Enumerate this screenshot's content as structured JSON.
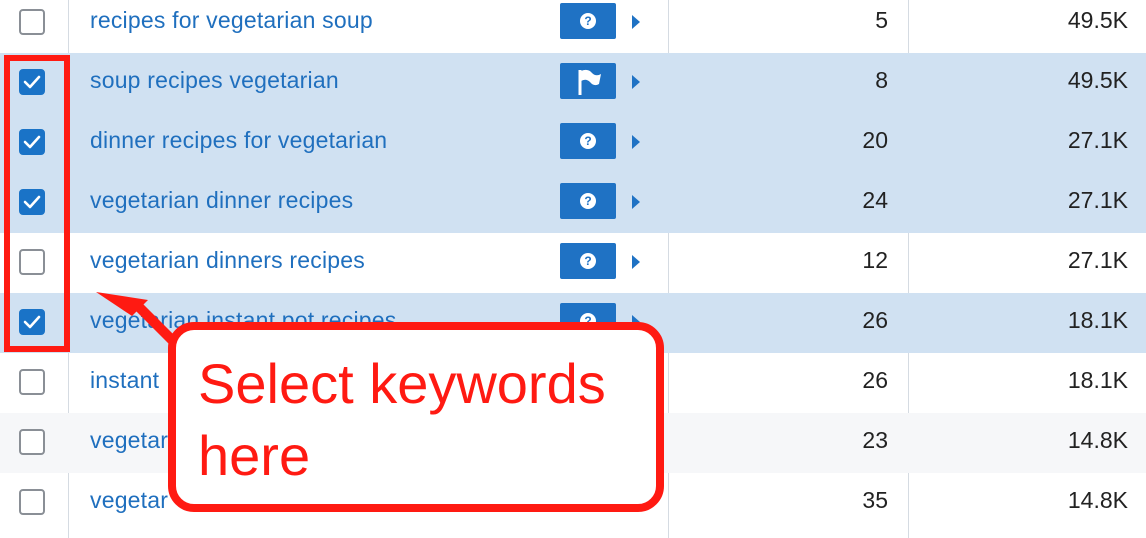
{
  "rows": [
    {
      "keyword": "recipes for vegetarian soup",
      "checked": false,
      "intent_icon": "question-icon",
      "kd": "5",
      "volume": "49.5K",
      "state": "plain"
    },
    {
      "keyword": "soup recipes vegetarian",
      "checked": true,
      "intent_icon": "flag-icon",
      "kd": "8",
      "volume": "49.5K",
      "state": "selected"
    },
    {
      "keyword": "dinner recipes for vegetarian",
      "checked": true,
      "intent_icon": "question-icon",
      "kd": "20",
      "volume": "27.1K",
      "state": "selected"
    },
    {
      "keyword": "vegetarian dinner recipes",
      "checked": true,
      "intent_icon": "question-icon",
      "kd": "24",
      "volume": "27.1K",
      "state": "selected"
    },
    {
      "keyword": "vegetarian dinners recipes",
      "checked": false,
      "intent_icon": "question-icon",
      "kd": "12",
      "volume": "27.1K",
      "state": "plain"
    },
    {
      "keyword": "vegetarian instant pot recipes",
      "checked": true,
      "intent_icon": "question-icon",
      "kd": "26",
      "volume": "18.1K",
      "state": "selected"
    },
    {
      "keyword": "instant",
      "checked": false,
      "intent_icon": "",
      "kd": "26",
      "volume": "18.1K",
      "state": "plain"
    },
    {
      "keyword": "vegetar",
      "checked": false,
      "intent_icon": "",
      "kd": "23",
      "volume": "14.8K",
      "state": "alt"
    },
    {
      "keyword": "vegetar",
      "checked": false,
      "intent_icon": "",
      "kd": "35",
      "volume": "14.8K",
      "state": "plain"
    }
  ],
  "annotation": {
    "text": "Select keywords here"
  },
  "colors": {
    "link": "#1f6fbe",
    "selected_row": "#d0e1f2",
    "checkbox": "#1a73c7",
    "annotation": "#ff1a12"
  }
}
